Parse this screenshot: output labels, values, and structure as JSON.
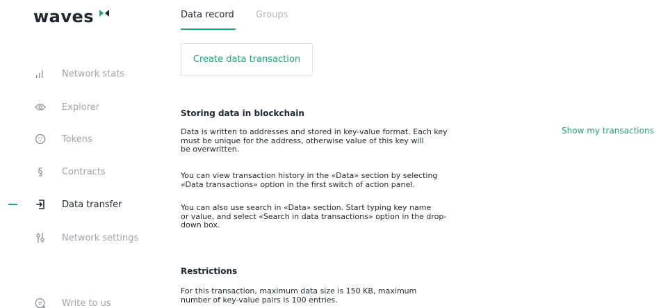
{
  "logo": {
    "text": "waves"
  },
  "sidebar": {
    "items": [
      {
        "label": "Network stats",
        "icon": "bar-chart-icon",
        "active": false
      },
      {
        "label": "Explorer",
        "icon": "eye-icon",
        "active": false
      },
      {
        "label": "Tokens",
        "icon": "token-icon",
        "active": false
      },
      {
        "label": "Contracts",
        "icon": "section-icon",
        "active": false
      },
      {
        "label": "Data transfer",
        "icon": "data-transfer-icon",
        "active": true
      },
      {
        "label": "Network settings",
        "icon": "settings-sliders-icon",
        "active": false
      },
      {
        "label": "Write to us",
        "icon": "chat-icon",
        "active": false
      }
    ]
  },
  "tabs": [
    {
      "label": "Data record",
      "active": true
    },
    {
      "label": "Groups",
      "active": false
    }
  ],
  "main": {
    "create_button": "Create data transaction",
    "show_transactions": "Show my transactions",
    "section1": {
      "title": "Storing data in blockchain",
      "paragraphs": [
        [
          "Data is written to addresses and stored in key-value format. Each key",
          "must be unique for the address, otherwise value of this key will",
          "be overwritten."
        ],
        [
          "You can view transaction history in the «Data» section by selecting",
          "«Data transactions» option in the first switch of action panel."
        ],
        [
          "You can also use search in «Data» section. Start typing key name",
          "or value, and select «Search in data transactions» option in the drop-",
          "down box."
        ]
      ]
    },
    "section2": {
      "title": "Restrictions",
      "paragraphs": [
        [
          "For this transaction, maximum data size is 150 KB, maximum",
          "number of key-value pairs is 100 entries."
        ]
      ]
    }
  },
  "colors": {
    "accent": "#1ea37b",
    "text": "#1f2733",
    "muted": "#9ea4ad",
    "border": "#dfe3e6"
  }
}
